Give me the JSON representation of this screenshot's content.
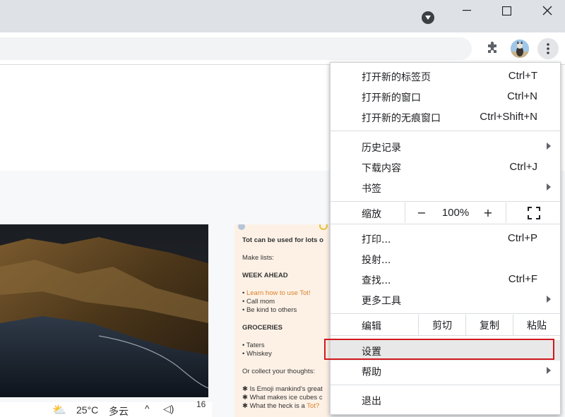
{
  "menu": {
    "new_tab": {
      "label": "打开新的标签页",
      "shortcut": "Ctrl+T"
    },
    "new_window": {
      "label": "打开新的窗口",
      "shortcut": "Ctrl+N"
    },
    "new_incognito": {
      "label": "打开新的无痕窗口",
      "shortcut": "Ctrl+Shift+N"
    },
    "history": {
      "label": "历史记录"
    },
    "downloads": {
      "label": "下载内容",
      "shortcut": "Ctrl+J"
    },
    "bookmarks": {
      "label": "书签"
    },
    "zoom": {
      "label": "缩放",
      "minus": "−",
      "value": "100%",
      "plus": "+"
    },
    "print": {
      "label": "打印...",
      "shortcut": "Ctrl+P"
    },
    "cast": {
      "label": "投射..."
    },
    "find": {
      "label": "查找...",
      "shortcut": "Ctrl+F"
    },
    "more_tools": {
      "label": "更多工具"
    },
    "edit": {
      "label": "编辑",
      "cut": "剪切",
      "copy": "复制",
      "paste": "粘贴"
    },
    "settings": {
      "label": "设置"
    },
    "help": {
      "label": "帮助"
    },
    "exit": {
      "label": "退出"
    }
  },
  "page": {
    "tot": {
      "line1": "Tot can be used for lots o",
      "line2": "Make lists:",
      "line3": "WEEK AHEAD",
      "line4": "Learn how to use Tot!",
      "line5": "Call mom",
      "line6": "Be kind to others",
      "line7": "GROCERIES",
      "line8": "Taters",
      "line9": "Whiskey",
      "line10": "Or collect your thoughts:",
      "line11": "Is Emoji mankind's great",
      "line12": "What makes ice cubes c",
      "line13": "What the heck is a",
      "line13_link": "Tot?"
    },
    "taskbar": {
      "temp": "25°C",
      "weather": "多云",
      "time_frag": "16"
    }
  },
  "colors": {
    "highlight_border": "#d0191f",
    "accent_tot": "#d9822b"
  },
  "icons": [
    "minimize-icon",
    "maximize-icon",
    "close-icon",
    "profile-dropdown-icon",
    "extensions-icon",
    "avatar-icon",
    "more-menu-icon",
    "fullscreen-icon"
  ]
}
